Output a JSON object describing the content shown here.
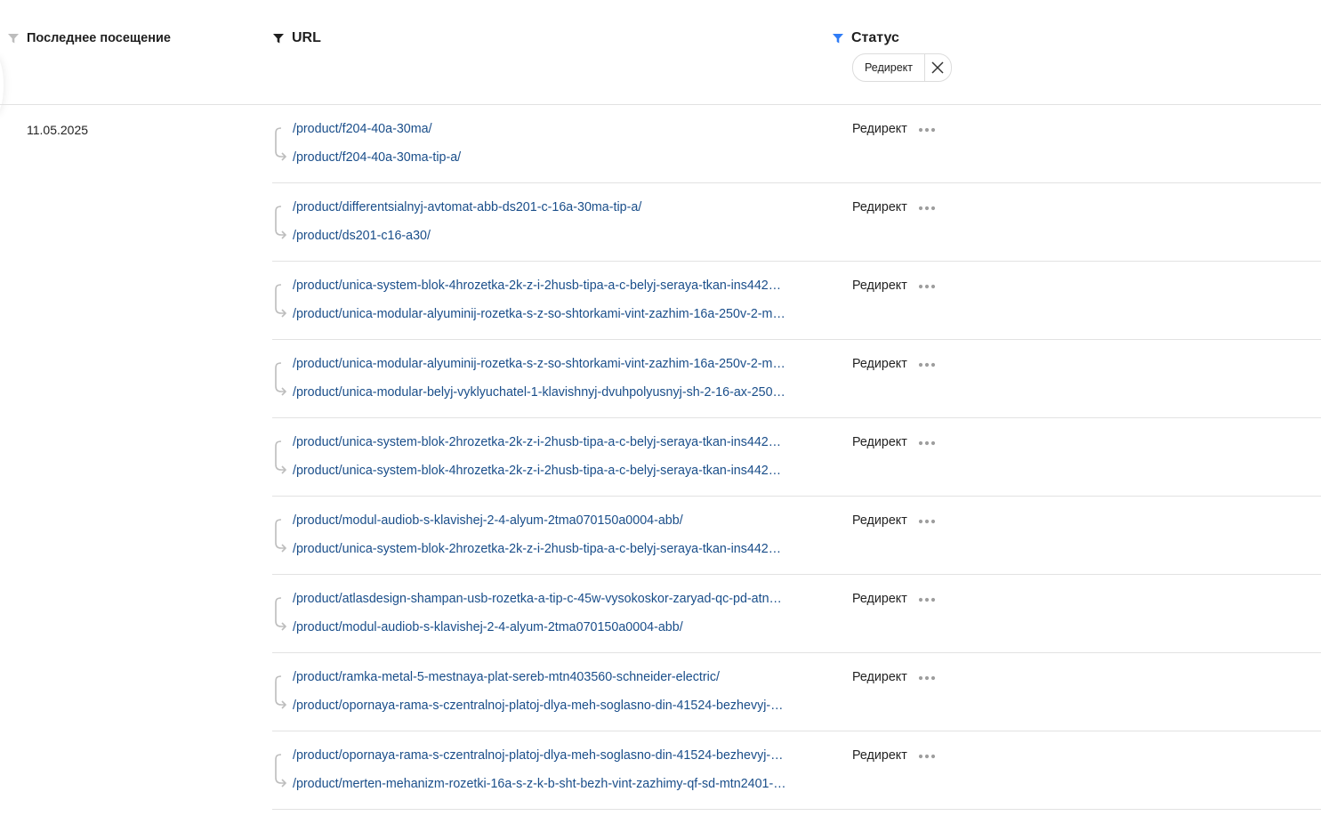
{
  "header": {
    "last_visit": "Последнее посещение",
    "url": "URL",
    "status": "Статус"
  },
  "filter_chip": {
    "label": "Редирект"
  },
  "colors": {
    "link": "#1a4e8a",
    "active_filter": "#2f7cf6",
    "inactive_filter": "#bdbdbd",
    "divider": "#e2e2e2"
  },
  "date": "11.05.2025",
  "rows": [
    {
      "from": "/product/f204-40a-30ma/",
      "to": "/product/f204-40a-30ma-tip-a/",
      "status": "Редирект"
    },
    {
      "from": "/product/differentsialnyj-avtomat-abb-ds201-c-16a-30ma-tip-a/",
      "to": "/product/ds201-c16-a30/",
      "status": "Редирект"
    },
    {
      "from": "/product/unica-system-blok-4hrozetka-2k-z-i-2husb-tipa-a-c-belyj-seraya-tkan-ins442…",
      "to": "/product/unica-modular-alyuminij-rozetka-s-z-so-shtorkami-vint-zazhim-16a-250v-2-m…",
      "status": "Редирект"
    },
    {
      "from": "/product/unica-modular-alyuminij-rozetka-s-z-so-shtorkami-vint-zazhim-16a-250v-2-m…",
      "to": "/product/unica-modular-belyj-vyklyuchatel-1-klavishnyj-dvuhpolyusnyj-sh-2-16-ax-250…",
      "status": "Редирект"
    },
    {
      "from": "/product/unica-system-blok-2hrozetka-2k-z-i-2husb-tipa-a-c-belyj-seraya-tkan-ins442…",
      "to": "/product/unica-system-blok-4hrozetka-2k-z-i-2husb-tipa-a-c-belyj-seraya-tkan-ins442…",
      "status": "Редирект"
    },
    {
      "from": "/product/modul-audiob-s-klavishej-2-4-alyum-2tma070150a0004-abb/",
      "to": "/product/unica-system-blok-2hrozetka-2k-z-i-2husb-tipa-a-c-belyj-seraya-tkan-ins442…",
      "status": "Редирект"
    },
    {
      "from": "/product/atlasdesign-shampan-usb-rozetka-a-tip-c-45w-vysokoskor-zaryad-qc-pd-atn…",
      "to": "/product/modul-audiob-s-klavishej-2-4-alyum-2tma070150a0004-abb/",
      "status": "Редирект"
    },
    {
      "from": "/product/ramka-metal-5-mestnaya-plat-sereb-mtn403560-schneider-electric/",
      "to": "/product/opornaya-rama-s-czentralnoj-platoj-dlya-meh-soglasno-din-41524-bezhevyj-…",
      "status": "Редирект"
    },
    {
      "from": "/product/opornaya-rama-s-czentralnoj-platoj-dlya-meh-soglasno-din-41524-bezhevyj-…",
      "to": "/product/merten-mehanizm-rozetki-16a-s-z-k-b-sht-bezh-vint-zazhimy-qf-sd-mtn2401-…",
      "status": "Редирект"
    }
  ]
}
